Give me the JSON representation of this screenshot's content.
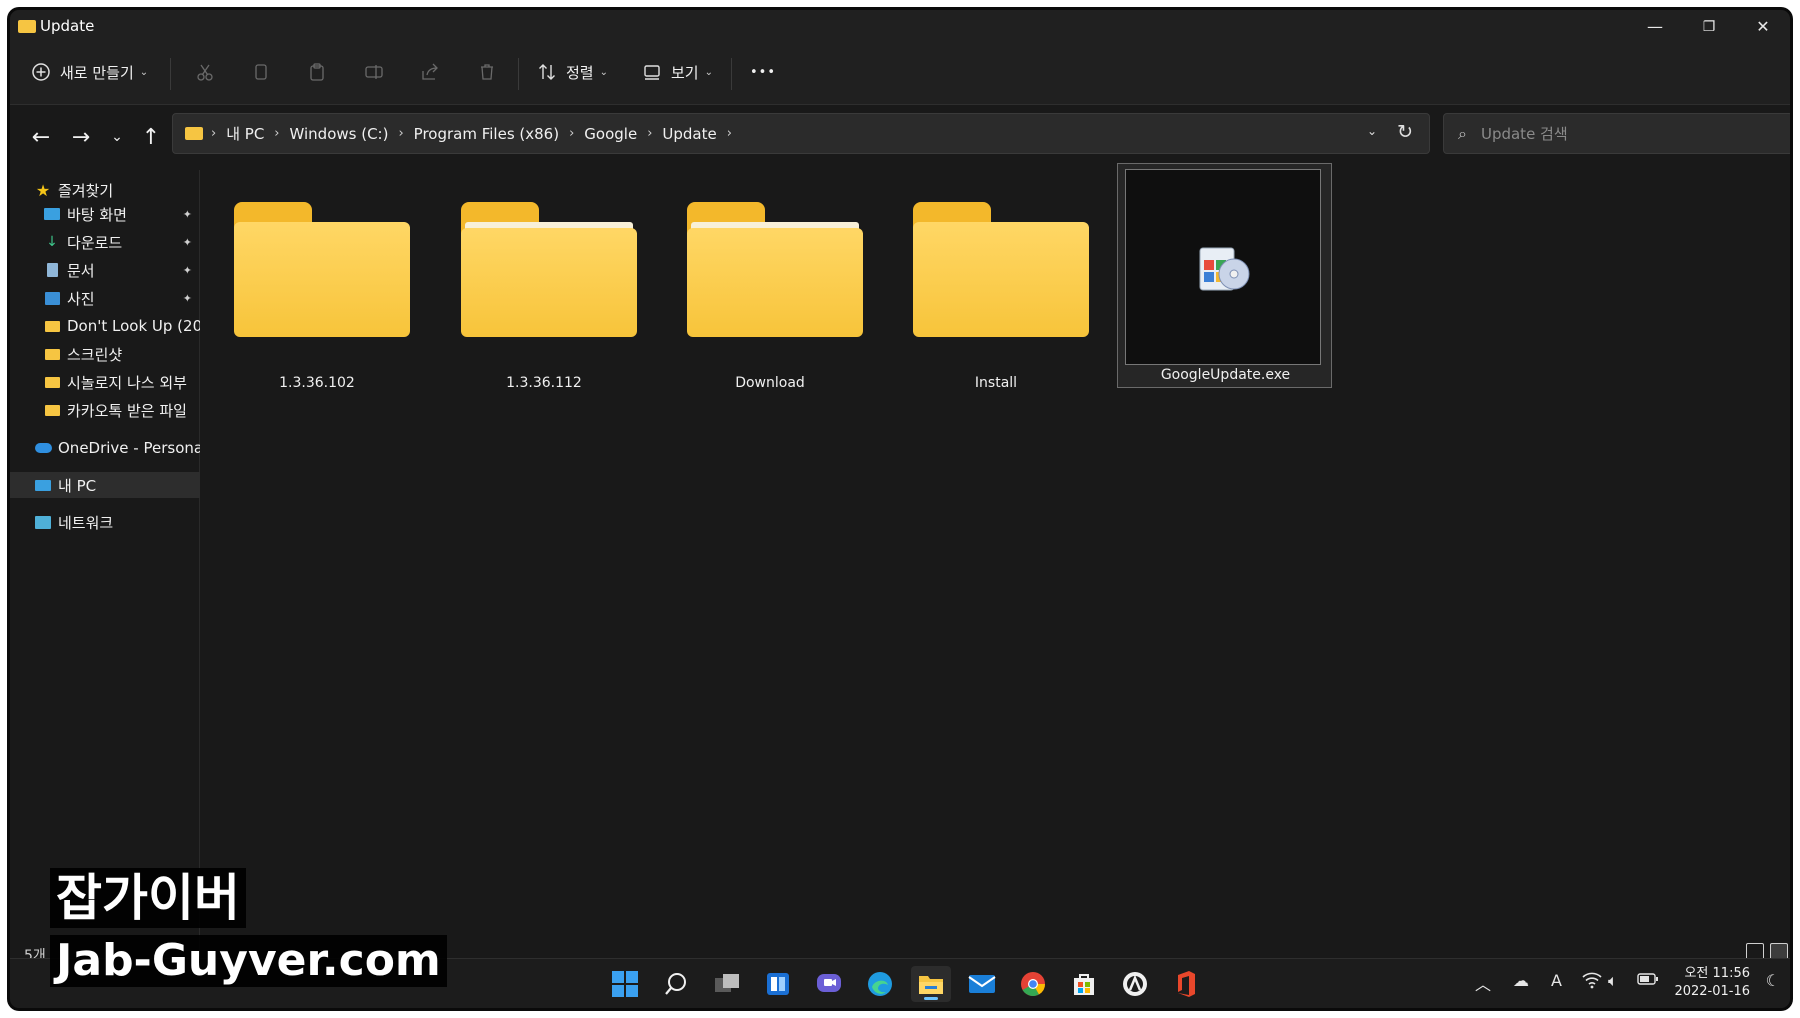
{
  "window": {
    "title": "Update",
    "minimize_glyph": "—",
    "maximize_glyph": "❐",
    "close_glyph": "✕"
  },
  "toolbar": {
    "new_label": "새로 만들기",
    "sort_label": "정렬",
    "view_label": "보기",
    "more_glyph": "•••"
  },
  "address": {
    "crumbs": [
      "내 PC",
      "Windows (C:)",
      "Program Files (x86)",
      "Google",
      "Update"
    ],
    "search_placeholder": "Update 검색"
  },
  "sidebar": {
    "quick_access": "즐겨찾기",
    "items": [
      {
        "label": "바탕 화면",
        "icon": "desktop-icon",
        "pinned": true
      },
      {
        "label": "다운로드",
        "icon": "download-icon",
        "pinned": true
      },
      {
        "label": "문서",
        "icon": "document-icon",
        "pinned": true
      },
      {
        "label": "사진",
        "icon": "picture-icon",
        "pinned": true
      },
      {
        "label": "Don't Look Up (20",
        "icon": "folder-icon",
        "pinned": false
      },
      {
        "label": "스크린샷",
        "icon": "folder-icon",
        "pinned": false
      },
      {
        "label": "시놀로지 나스 외부",
        "icon": "folder-icon",
        "pinned": false
      },
      {
        "label": "카카오톡 받은 파일",
        "icon": "folder-icon",
        "pinned": false
      }
    ],
    "onedrive": "OneDrive - Personal",
    "this_pc": "내 PC",
    "network": "네트워크"
  },
  "files": [
    {
      "name": "1.3.36.102",
      "type": "folder",
      "has_contents": false
    },
    {
      "name": "1.3.36.112",
      "type": "folder",
      "has_contents": true
    },
    {
      "name": "Download",
      "type": "folder",
      "has_contents": true
    },
    {
      "name": "Install",
      "type": "folder",
      "has_contents": false
    },
    {
      "name": "GoogleUpdate.exe",
      "type": "exe",
      "selected": true
    }
  ],
  "status": {
    "item_count": "5개"
  },
  "taskbar": {
    "clock_ampm_time": "오전 11:56",
    "date": "2022-01-16",
    "ime": "A"
  },
  "watermark": {
    "line1": "잡가이버",
    "line2": "Jab-Guyver.com"
  },
  "colors": {
    "folder": "#f7c43a",
    "accent": "#6cc4ff",
    "background": "#191919"
  }
}
